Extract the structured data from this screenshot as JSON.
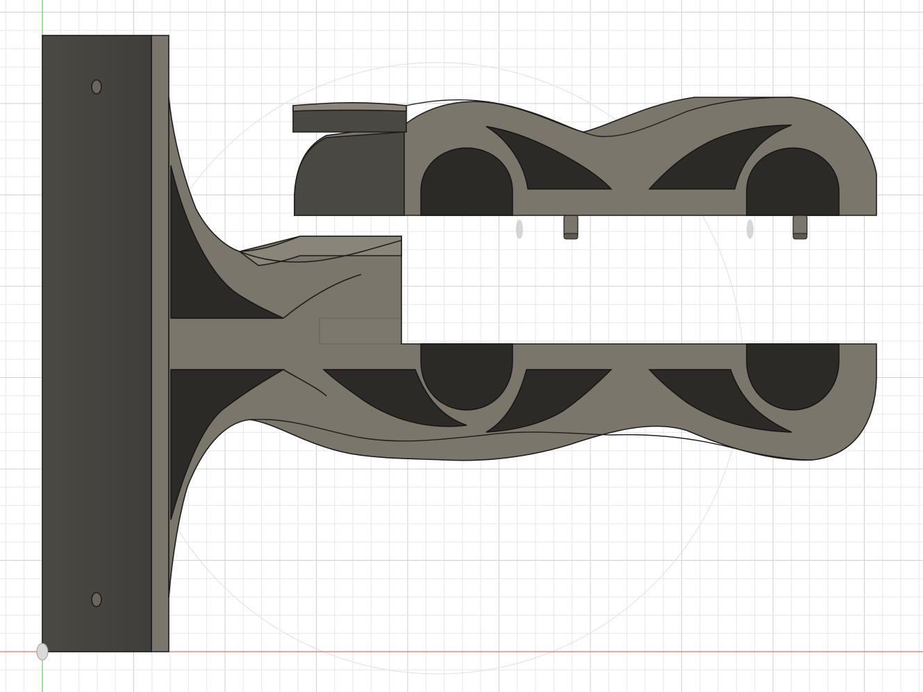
{
  "viewport": {
    "background": "#ffffff",
    "grid": {
      "visible": true,
      "minor_color": "#e7e7e7",
      "major_color": "#cfcfcf"
    },
    "axes": {
      "x_axis_color": "#ef6a6a",
      "y_axis_color": "#5fd35f"
    },
    "origin_marker": "origin-icon"
  },
  "model": {
    "type": "bracket",
    "body_color": "#7b766c",
    "shade_color": "#4a4843",
    "cavity_color": "#2b2a27",
    "outline_color": "#1e1d1b",
    "parts": [
      "wall-plate",
      "lower-arm",
      "upper-clamp"
    ],
    "mount_holes": 2,
    "alignment_pins": 2,
    "rod_slots": 2
  }
}
